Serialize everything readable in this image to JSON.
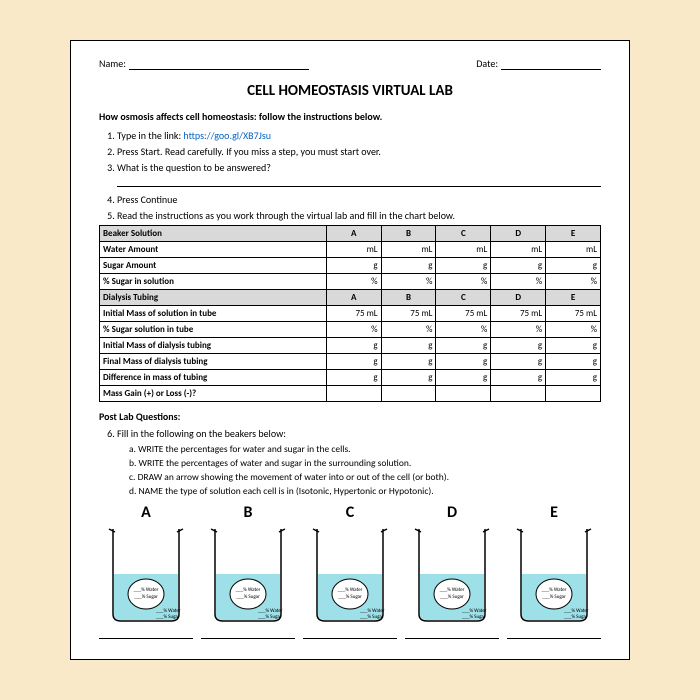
{
  "header": {
    "nameLabel": "Name:",
    "dateLabel": "Date:"
  },
  "title": "CELL HOMEOSTASIS VIRTUAL LAB",
  "intro": "How osmosis affects cell homeostasis:  follow the instructions below.",
  "steps": {
    "s1a": "Type in the link:  ",
    "s1link": "https://goo.gl/XB7Jsu",
    "s2": "Press Start.  Read carefully.  If you miss a step, you must start over.",
    "s3": "What is the question to be answered?",
    "s4": "Press Continue",
    "s5": "Read the instructions as you work through the virtual lab and fill in the chart below."
  },
  "table": {
    "cols": [
      "A",
      "B",
      "C",
      "D",
      "E"
    ],
    "rows": [
      {
        "h": "Beaker Solution",
        "vals": [
          "A",
          "B",
          "C",
          "D",
          "E"
        ],
        "hdr": true
      },
      {
        "h": "Water Amount",
        "vals": [
          "mL",
          "mL",
          "mL",
          "mL",
          "mL"
        ]
      },
      {
        "h": "Sugar Amount",
        "vals": [
          "g",
          "g",
          "g",
          "g",
          "g"
        ]
      },
      {
        "h": "% Sugar in solution",
        "vals": [
          "%",
          "%",
          "%",
          "%",
          "%"
        ]
      },
      {
        "h": "Dialysis Tubing",
        "vals": [
          "A",
          "B",
          "C",
          "D",
          "E"
        ],
        "hdr": true
      },
      {
        "h": "Initial Mass of solution in tube",
        "vals": [
          "75 mL",
          "75 mL",
          "75 mL",
          "75 mL",
          "75 mL"
        ]
      },
      {
        "h": "% Sugar solution in tube",
        "vals": [
          "%",
          "%",
          "%",
          "%",
          "%"
        ]
      },
      {
        "h": "Initial Mass of dialysis tubing",
        "vals": [
          "g",
          "g",
          "g",
          "g",
          "g"
        ]
      },
      {
        "h": "Final Mass of dialysis tubing",
        "vals": [
          "g",
          "g",
          "g",
          "g",
          "g"
        ]
      },
      {
        "h": "Difference in mass of tubing",
        "vals": [
          "g",
          "g",
          "g",
          "g",
          "g"
        ]
      },
      {
        "h": "Mass Gain (+) or Loss (-)?",
        "vals": [
          "",
          "",
          "",
          "",
          ""
        ]
      }
    ]
  },
  "postLabTitle": "Post Lab Questions:",
  "q6": "Fill in the following on the beakers below:",
  "q6sub": [
    "a.   WRITE the percentages for water and sugar in the cells.",
    "b.   WRITE the percentages of water and sugar in the surrounding solution.",
    "c.   DRAW an arrow showing the movement of water into or out of the cell (or both).",
    "d.   NAME the type of solution each cell is in (Isotonic, Hypertonic or Hypotonic)."
  ],
  "beakerLabels": [
    "A",
    "B",
    "C",
    "D",
    "E"
  ],
  "cellLabels": {
    "water": "% Water",
    "sugar": "% Sugar"
  }
}
